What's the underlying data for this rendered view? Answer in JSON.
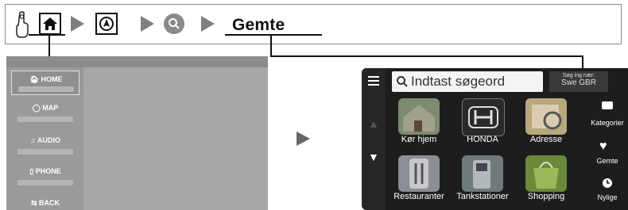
{
  "breadcrumb": {
    "home_icon": "home-icon",
    "nav_icon": "navigation-icon",
    "search_icon": "search-icon",
    "current_label": "Gemte"
  },
  "home_menu": {
    "items": [
      {
        "label": "HOME",
        "icon": "home-icon"
      },
      {
        "label": "MAP",
        "icon": "map-icon"
      },
      {
        "label": "AUDIO",
        "icon": "music-note-icon"
      },
      {
        "label": "PHONE",
        "icon": "phone-icon"
      },
      {
        "label": "BACK",
        "icon": "back-icon"
      }
    ]
  },
  "nav_screen": {
    "search_placeholder": "Indtast søgeord",
    "search_near_label": "Søg ing nær:",
    "search_near_value": "Swe GBR",
    "tiles": [
      {
        "label": "Kør hjem"
      },
      {
        "label": "HONDA"
      },
      {
        "label": "Adresse"
      },
      {
        "label": "Restauranter"
      },
      {
        "label": "Tankstationer"
      },
      {
        "label": "Shopping"
      }
    ],
    "side_buttons": [
      {
        "label": "Kategorier",
        "icon": "speech-bubble-icon"
      },
      {
        "label": "Gemte",
        "icon": "heart-icon"
      },
      {
        "label": "Nylige",
        "icon": "clock-icon"
      }
    ]
  }
}
